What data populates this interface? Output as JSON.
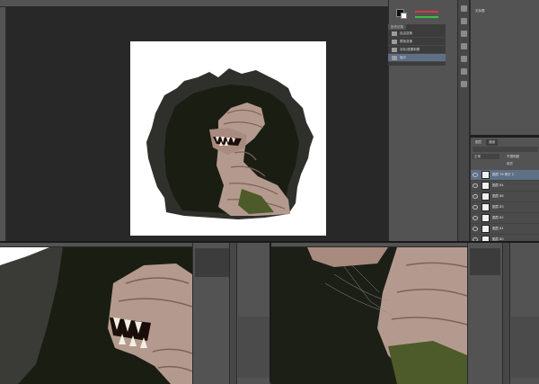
{
  "panel_title": "无标题",
  "history": {
    "tab": "历史记录",
    "items": [
      {
        "label": "自由变换"
      },
      {
        "label": "蒙版变换"
      },
      {
        "label": "羽化/遮罩和擦"
      },
      {
        "label": "隐约"
      }
    ]
  },
  "layers": {
    "tabs": [
      "图层",
      "通道"
    ],
    "blend_mode": "正常",
    "opacity_label": "不透明度",
    "fill_label": "填充",
    "items": [
      {
        "label": "图层 76 拷贝 2"
      },
      {
        "label": "图层 84"
      },
      {
        "label": "图层 86"
      },
      {
        "label": "图层 83"
      },
      {
        "label": "图层 82"
      },
      {
        "label": "图层 81"
      },
      {
        "label": "图层 80"
      }
    ]
  },
  "colors": {
    "workspace": "#323232",
    "canvas_bg": "#282828",
    "panel": "#535353",
    "selection": "#5e6f86",
    "slider_red": "#d83a3a",
    "slider_green": "#3bbf4a"
  },
  "icons": [
    "move-icon",
    "marquee-icon",
    "lasso-icon",
    "crop-icon",
    "eyedropper-icon",
    "brush-icon",
    "eraser-icon",
    "gradient-icon",
    "pen-icon",
    "text-icon",
    "hand-icon",
    "zoom-icon"
  ]
}
